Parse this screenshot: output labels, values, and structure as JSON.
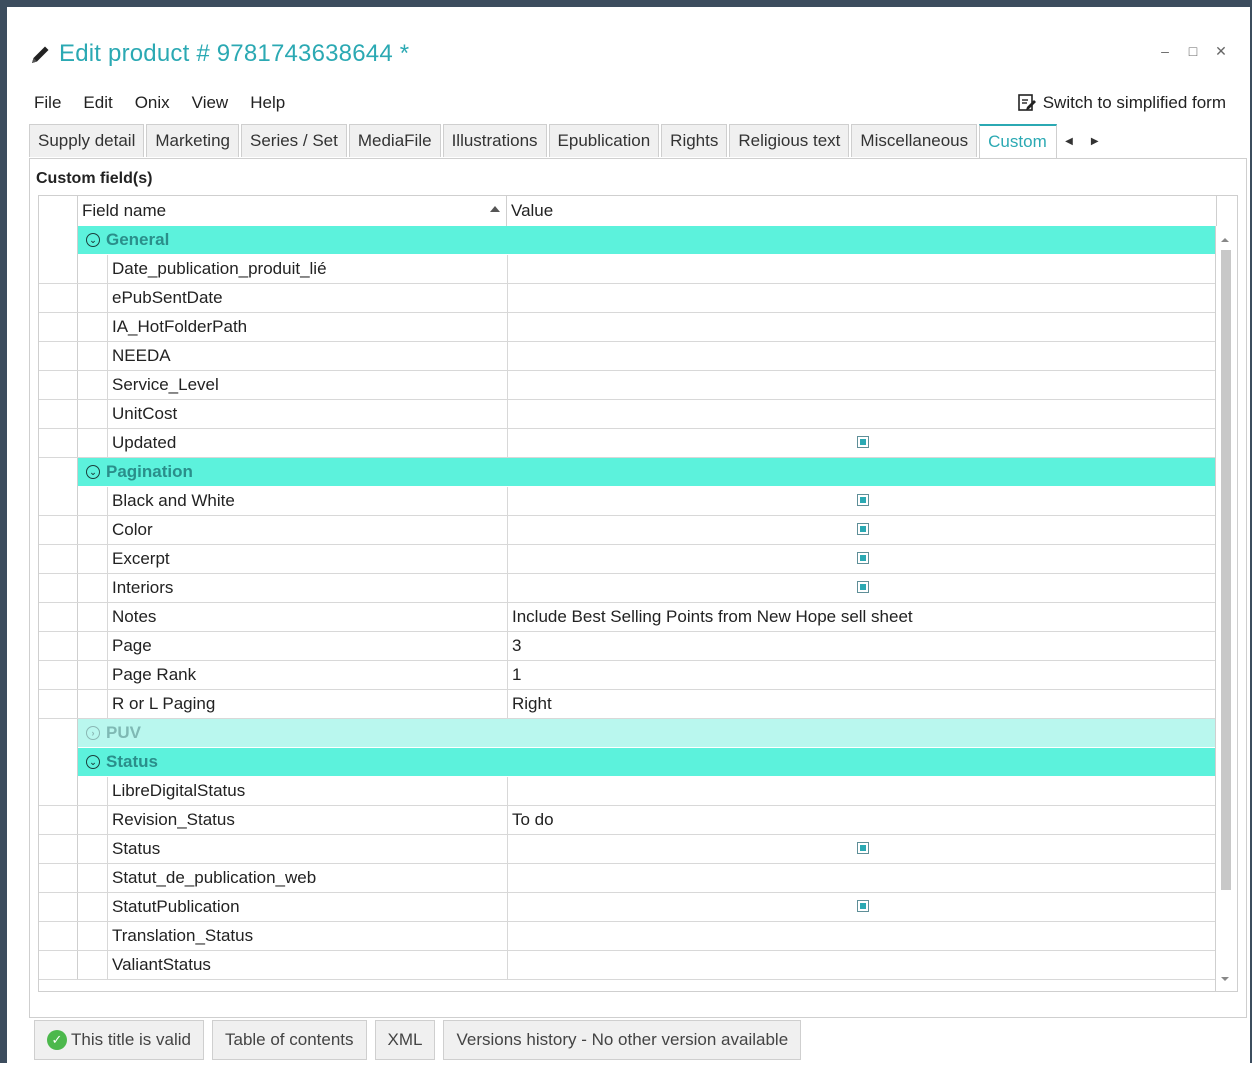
{
  "window": {
    "title": "Edit product # 9781743638644 *",
    "controls": {
      "minimize": "–",
      "maximize": "□",
      "close": "✕"
    }
  },
  "menu": [
    "File",
    "Edit",
    "Onix",
    "View",
    "Help"
  ],
  "switch_label": "Switch to simplified form",
  "tabs": [
    "Supply detail",
    "Marketing",
    "Series / Set",
    "MediaFile",
    "Illustrations",
    "Epublication",
    "Rights",
    "Religious text",
    "Miscellaneous",
    "Custom"
  ],
  "active_tab": "Custom",
  "section_title": "Custom field(s)",
  "grid": {
    "headers": {
      "field": "Field name",
      "value": "Value"
    },
    "rows": [
      {
        "type": "group",
        "label": "General",
        "expanded": true
      },
      {
        "type": "field",
        "name": "Date_publication_produit_lié",
        "value": ""
      },
      {
        "type": "field",
        "name": "ePubSentDate",
        "value": ""
      },
      {
        "type": "field",
        "name": "IA_HotFolderPath",
        "value": ""
      },
      {
        "type": "field",
        "name": "NEEDA",
        "value": ""
      },
      {
        "type": "field",
        "name": "Service_Level",
        "value": ""
      },
      {
        "type": "field",
        "name": "UnitCost",
        "value": ""
      },
      {
        "type": "field",
        "name": "Updated",
        "value": "",
        "checkbox": true
      },
      {
        "type": "group",
        "label": "Pagination",
        "expanded": true
      },
      {
        "type": "field",
        "name": "Black and White",
        "value": "",
        "checkbox": true
      },
      {
        "type": "field",
        "name": "Color",
        "value": "",
        "checkbox": true
      },
      {
        "type": "field",
        "name": "Excerpt",
        "value": "",
        "checkbox": true
      },
      {
        "type": "field",
        "name": "Interiors",
        "value": "",
        "checkbox": true
      },
      {
        "type": "field",
        "name": "Notes",
        "value": "Include Best Selling Points from New Hope sell sheet"
      },
      {
        "type": "field",
        "name": "Page",
        "value": "3"
      },
      {
        "type": "field",
        "name": "Page Rank",
        "value": "1"
      },
      {
        "type": "field",
        "name": "R or L Paging",
        "value": "Right"
      },
      {
        "type": "group",
        "label": "PUV",
        "expanded": false
      },
      {
        "type": "group",
        "label": "Status",
        "expanded": true
      },
      {
        "type": "field",
        "name": "LibreDigitalStatus",
        "value": ""
      },
      {
        "type": "field",
        "name": "Revision_Status",
        "value": "To do"
      },
      {
        "type": "field",
        "name": "Status",
        "value": "",
        "checkbox": true
      },
      {
        "type": "field",
        "name": "Statut_de_publication_web",
        "value": ""
      },
      {
        "type": "field",
        "name": "StatutPublication",
        "value": "",
        "checkbox": true
      },
      {
        "type": "field",
        "name": "Translation_Status",
        "value": ""
      },
      {
        "type": "field",
        "name": "ValiantStatus",
        "value": ""
      }
    ]
  },
  "bottom_buttons": [
    "This title is valid",
    "Table of contents",
    "XML",
    "Versions history - No other version available"
  ],
  "colors": {
    "accent": "#2ba9b3",
    "group_bg": "#5cf2dc",
    "group_collapsed_bg": "#b9f7ee",
    "valid_icon": "#4cb84c"
  }
}
